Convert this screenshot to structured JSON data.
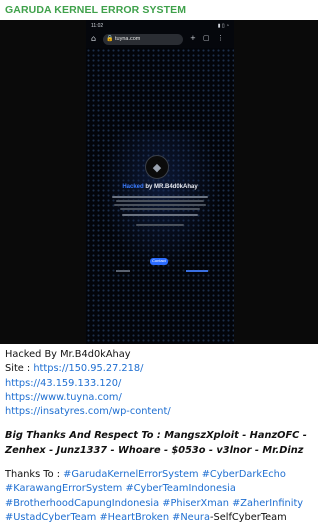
{
  "header": {
    "title": "GARUDA KERNEL ERROR SYSTEM",
    "title_color": "#3fa14b"
  },
  "screenshot": {
    "status_time": "11:02",
    "status_icons": "▮ ▯ ◔",
    "url": "tuyna.com",
    "hacked_prefix": "Hacked",
    "hacked_suffix": " by MR.B4d0kAhay",
    "button_label": "Contact"
  },
  "caption": {
    "hacked_by": "Hacked By Mr.B4d0kAhay",
    "site_label": "Site : ",
    "site_url": "https://150.95.27.218/",
    "links": [
      "https://43.159.133.120/",
      "https://www.tuyna.com/",
      "https://insatyres.com/wp-content/"
    ],
    "thanks_bold": "Big Thanks And Respect To : MangszXploit - HanzOFC - Zenhex - Junz1337 - Whoare - $053o - v3lnor - Mr.Dinz",
    "thanks_label": "Thanks To : ",
    "tags_line1": "#GarudaKernelErrorSystem #CyberDarkEcho",
    "tags_line2": "#KarawangErrorSystem #CyberTeamIndonesia",
    "tags_line3": "#BrotherhoodCapungIndonesia #PhiserXman #ZaherInfinity",
    "tags_line4a": "#UstadCyberTeam #HeartBroken #Neura",
    "tags_line4b": "-SelfCyberTeam"
  },
  "colors": {
    "link": "#1f6fd1",
    "accent_blue": "#3a7bff"
  }
}
